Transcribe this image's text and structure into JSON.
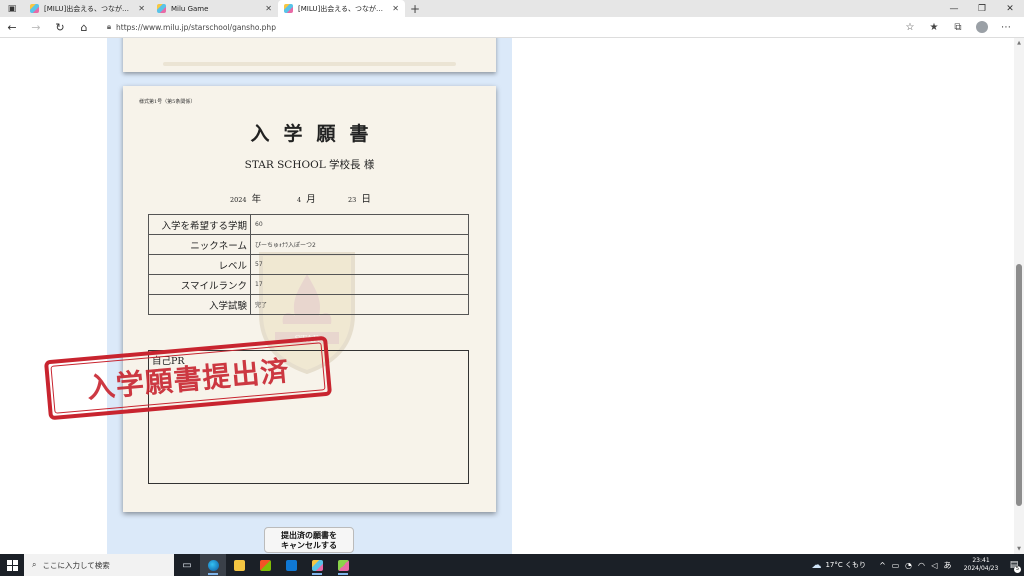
{
  "browser": {
    "tabs": [
      {
        "title": "[MILU]出会える、つながる、楽しめる",
        "active": false
      },
      {
        "title": "Milu Game",
        "active": false
      },
      {
        "title": "[MILU]出会える、つながる、楽しめる",
        "active": true
      }
    ],
    "url": "https://www.milu.jp/starschool/gansho.php"
  },
  "application": {
    "form_code": "様式第1号（第5条関係）",
    "title": "入学願書",
    "addressee": "STAR SCHOOL 学校長 様",
    "date": {
      "year": "2024",
      "year_unit": "年",
      "month": "4",
      "month_unit": "月",
      "day": "23",
      "day_unit": "日"
    },
    "rows": [
      {
        "label": "入学を希望する学期",
        "value": "60"
      },
      {
        "label": "ニックネーム",
        "value": "ぴーちゅｫﾅﾗ入ぽーつ2"
      },
      {
        "label": "レベル",
        "value": "57"
      },
      {
        "label": "スマイルランク",
        "value": "17"
      },
      {
        "label": "入学試験",
        "value": "完了"
      }
    ],
    "pr_label": "自己PR",
    "stamp_text": "入学願書提出済",
    "emblem_text": "STAR"
  },
  "cancel_button": {
    "line1": "提出済の願書を",
    "line2": "キャンセルする"
  },
  "taskbar": {
    "search_placeholder": "ここに入力して検索",
    "weather": "17°C くもり",
    "ime": "あ",
    "time": "23:41",
    "date": "2024/04/23",
    "notification_count": "5"
  },
  "colors": {
    "stamp_red": "#c8242f",
    "page_bg_blue": "#dbe9f9",
    "paper": "#f7f3ea",
    "taskbar": "#1b2027"
  }
}
